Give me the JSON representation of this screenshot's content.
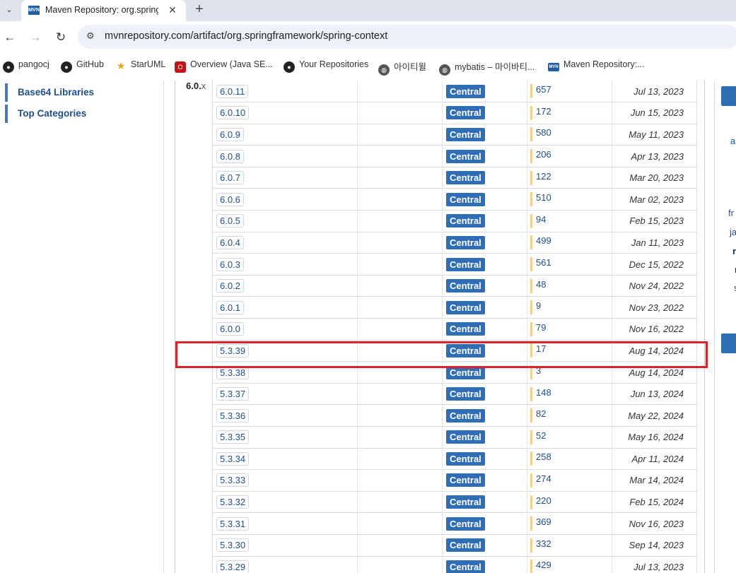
{
  "browser": {
    "tab_title": "Maven Repository: org.springfr",
    "tab_favicon": "MVN",
    "url": "mvnrepository.com/artifact/org.springframework/spring-context"
  },
  "bookmarks": [
    {
      "label": "pangocj",
      "icon": "github-icon"
    },
    {
      "label": "GitHub",
      "icon": "github-icon"
    },
    {
      "label": "StarUML",
      "icon": "star-icon"
    },
    {
      "label": "Overview (Java SE...",
      "icon": "oracle-icon"
    },
    {
      "label": "Your Repositories",
      "icon": "github-icon"
    },
    {
      "label": "아이티윌",
      "icon": "globe-icon"
    },
    {
      "label": "mybatis – 마이바티...",
      "icon": "globe-icon"
    },
    {
      "label": "Maven Repository:...",
      "icon": "mvn-icon"
    }
  ],
  "leftnav": [
    {
      "label": "Base64 Libraries"
    },
    {
      "label": "Top Categories"
    }
  ],
  "group_label": "6.0.",
  "group_label_suffix": "x",
  "versions": [
    {
      "version": "6.0.11",
      "repo": "Central",
      "usages": "657",
      "date": "Jul 13, 2023"
    },
    {
      "version": "6.0.10",
      "repo": "Central",
      "usages": "172",
      "date": "Jun 15, 2023"
    },
    {
      "version": "6.0.9",
      "repo": "Central",
      "usages": "580",
      "date": "May 11, 2023"
    },
    {
      "version": "6.0.8",
      "repo": "Central",
      "usages": "206",
      "date": "Apr 13, 2023"
    },
    {
      "version": "6.0.7",
      "repo": "Central",
      "usages": "122",
      "date": "Mar 20, 2023"
    },
    {
      "version": "6.0.6",
      "repo": "Central",
      "usages": "510",
      "date": "Mar 02, 2023"
    },
    {
      "version": "6.0.5",
      "repo": "Central",
      "usages": "94",
      "date": "Feb 15, 2023"
    },
    {
      "version": "6.0.4",
      "repo": "Central",
      "usages": "499",
      "date": "Jan 11, 2023"
    },
    {
      "version": "6.0.3",
      "repo": "Central",
      "usages": "561",
      "date": "Dec 15, 2022"
    },
    {
      "version": "6.0.2",
      "repo": "Central",
      "usages": "48",
      "date": "Nov 24, 2022"
    },
    {
      "version": "6.0.1",
      "repo": "Central",
      "usages": "9",
      "date": "Nov 23, 2022"
    },
    {
      "version": "6.0.0",
      "repo": "Central",
      "usages": "79",
      "date": "Nov 16, 2022"
    },
    {
      "version": "5.3.39",
      "repo": "Central",
      "usages": "17",
      "date": "Aug 14, 2024"
    },
    {
      "version": "5.3.38",
      "repo": "Central",
      "usages": "3",
      "date": "Aug 14, 2024"
    },
    {
      "version": "5.3.37",
      "repo": "Central",
      "usages": "148",
      "date": "Jun 13, 2024"
    },
    {
      "version": "5.3.36",
      "repo": "Central",
      "usages": "82",
      "date": "May 22, 2024"
    },
    {
      "version": "5.3.35",
      "repo": "Central",
      "usages": "52",
      "date": "May 16, 2024"
    },
    {
      "version": "5.3.34",
      "repo": "Central",
      "usages": "258",
      "date": "Apr 11, 2024"
    },
    {
      "version": "5.3.33",
      "repo": "Central",
      "usages": "274",
      "date": "Mar 14, 2024"
    },
    {
      "version": "5.3.32",
      "repo": "Central",
      "usages": "220",
      "date": "Feb 15, 2024"
    },
    {
      "version": "5.3.31",
      "repo": "Central",
      "usages": "369",
      "date": "Nov 16, 2023"
    },
    {
      "version": "5.3.30",
      "repo": "Central",
      "usages": "332",
      "date": "Sep 14, 2023"
    },
    {
      "version": "5.3.29",
      "repo": "Central",
      "usages": "429",
      "date": "Jul 13, 2023"
    }
  ],
  "right_sidebar_fragments": [
    "a",
    "fr",
    "ja",
    "r",
    "r",
    "s"
  ],
  "colors": {
    "link": "#1e4e8c",
    "badge": "#2f6db5",
    "highlight": "#d9232d",
    "usage_bar": "#f3cf8c"
  }
}
